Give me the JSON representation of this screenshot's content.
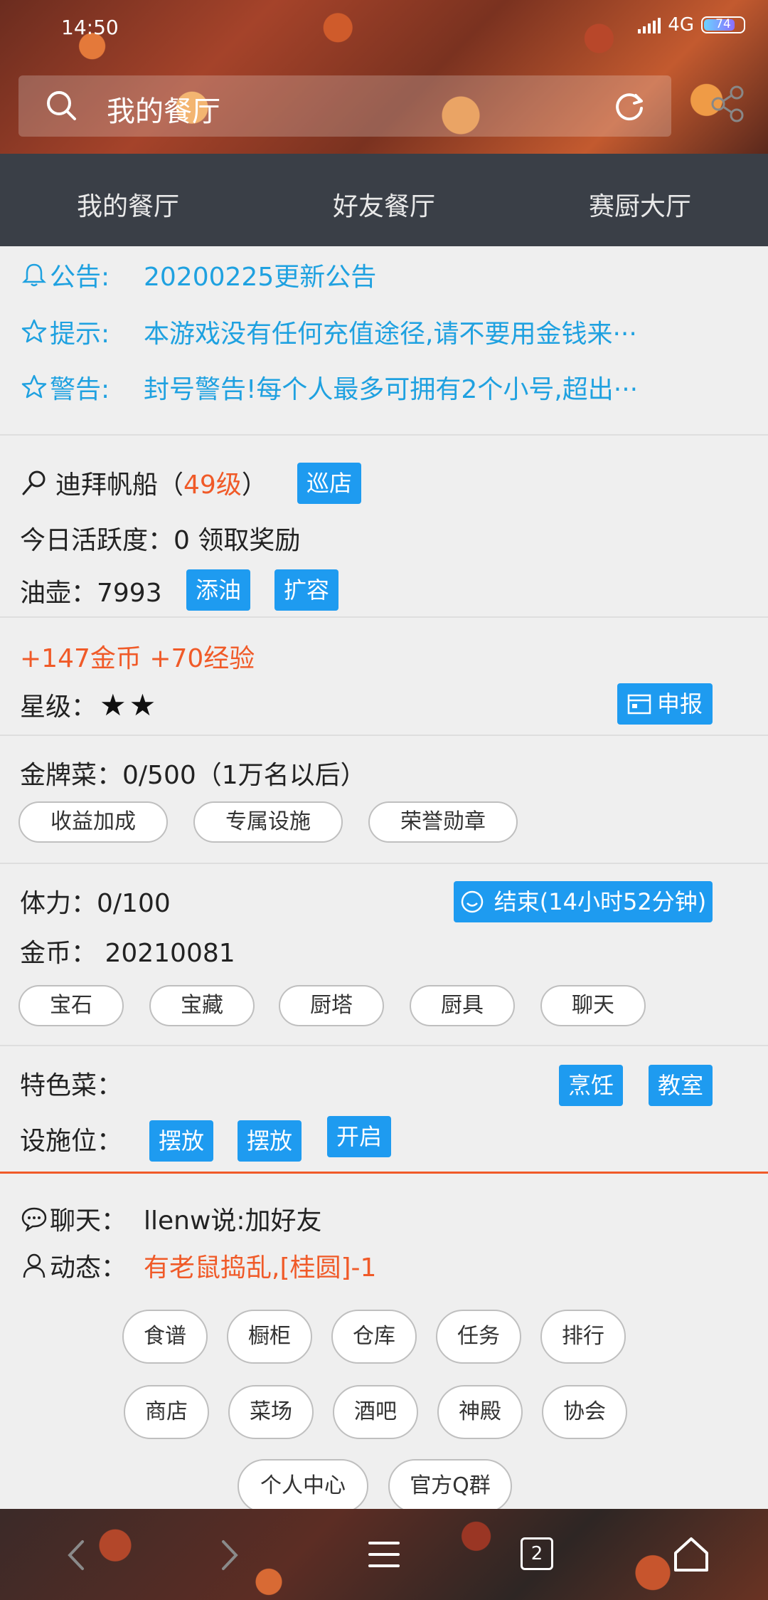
{
  "status_bar": {
    "time": "14:50",
    "network": "4G",
    "battery": "74"
  },
  "search": {
    "title": "我的餐厅"
  },
  "tabs": [
    {
      "label": "我的餐厅"
    },
    {
      "label": "好友餐厅"
    },
    {
      "label": "赛厨大厅"
    }
  ],
  "notices": [
    {
      "label": "公告:",
      "text": "20200225更新公告"
    },
    {
      "label": "提示:",
      "text": "本游戏没有任何充值途径,请不要用金钱来···"
    },
    {
      "label": "警告:",
      "text": "封号警告!每个人最多可拥有2个小号,超出···"
    }
  ],
  "restaurant": {
    "name": "迪拜帆船（",
    "level": "49级",
    "name_close": "）",
    "patrol_button": "巡店",
    "activity": "今日活跃度：0 领取奖励",
    "oil_label": "油壶：7993",
    "add_oil_button": "添油",
    "expand_button": "扩容"
  },
  "rewards": {
    "text": "+147金币 +70经验"
  },
  "star": {
    "label": "星级：",
    "count": 2,
    "declare_button": "申报"
  },
  "gold_dish": {
    "label": "金牌菜：0/500（1万名以后）",
    "buttons": [
      "收益加成",
      "专属设施",
      "荣誉勋章"
    ]
  },
  "stamina": {
    "label": "体力：0/100",
    "end_button": "结束(14小时52分钟)",
    "gold_label": "金币： 20210081",
    "buttons": [
      "宝石",
      "宝藏",
      "厨塔",
      "厨具",
      "聊天"
    ]
  },
  "special": {
    "label": "特色菜：",
    "cook_button": "烹饪",
    "classroom_button": "教室",
    "facility_label": "设施位：",
    "place1": "摆放",
    "place2": "摆放",
    "open": "开启"
  },
  "chat": {
    "label": "聊天：",
    "text": "llenw说:加好友"
  },
  "dynamic": {
    "label": "动态：",
    "text": "有老鼠捣乱,[桂圆]-1"
  },
  "menu_row1": [
    "食谱",
    "橱柜",
    "仓库",
    "任务",
    "排行"
  ],
  "menu_row2": [
    "商店",
    "菜场",
    "酒吧",
    "神殿",
    "协会"
  ],
  "menu_row3": [
    "个人中心",
    "官方Q群"
  ],
  "bottom_nav": {
    "tabs_count": "2"
  },
  "colors": {
    "accent_blue": "#1fa1e0",
    "button_blue": "#1e9bf0",
    "orange": "#f05a28",
    "tab_bar": "#3a3f47"
  }
}
